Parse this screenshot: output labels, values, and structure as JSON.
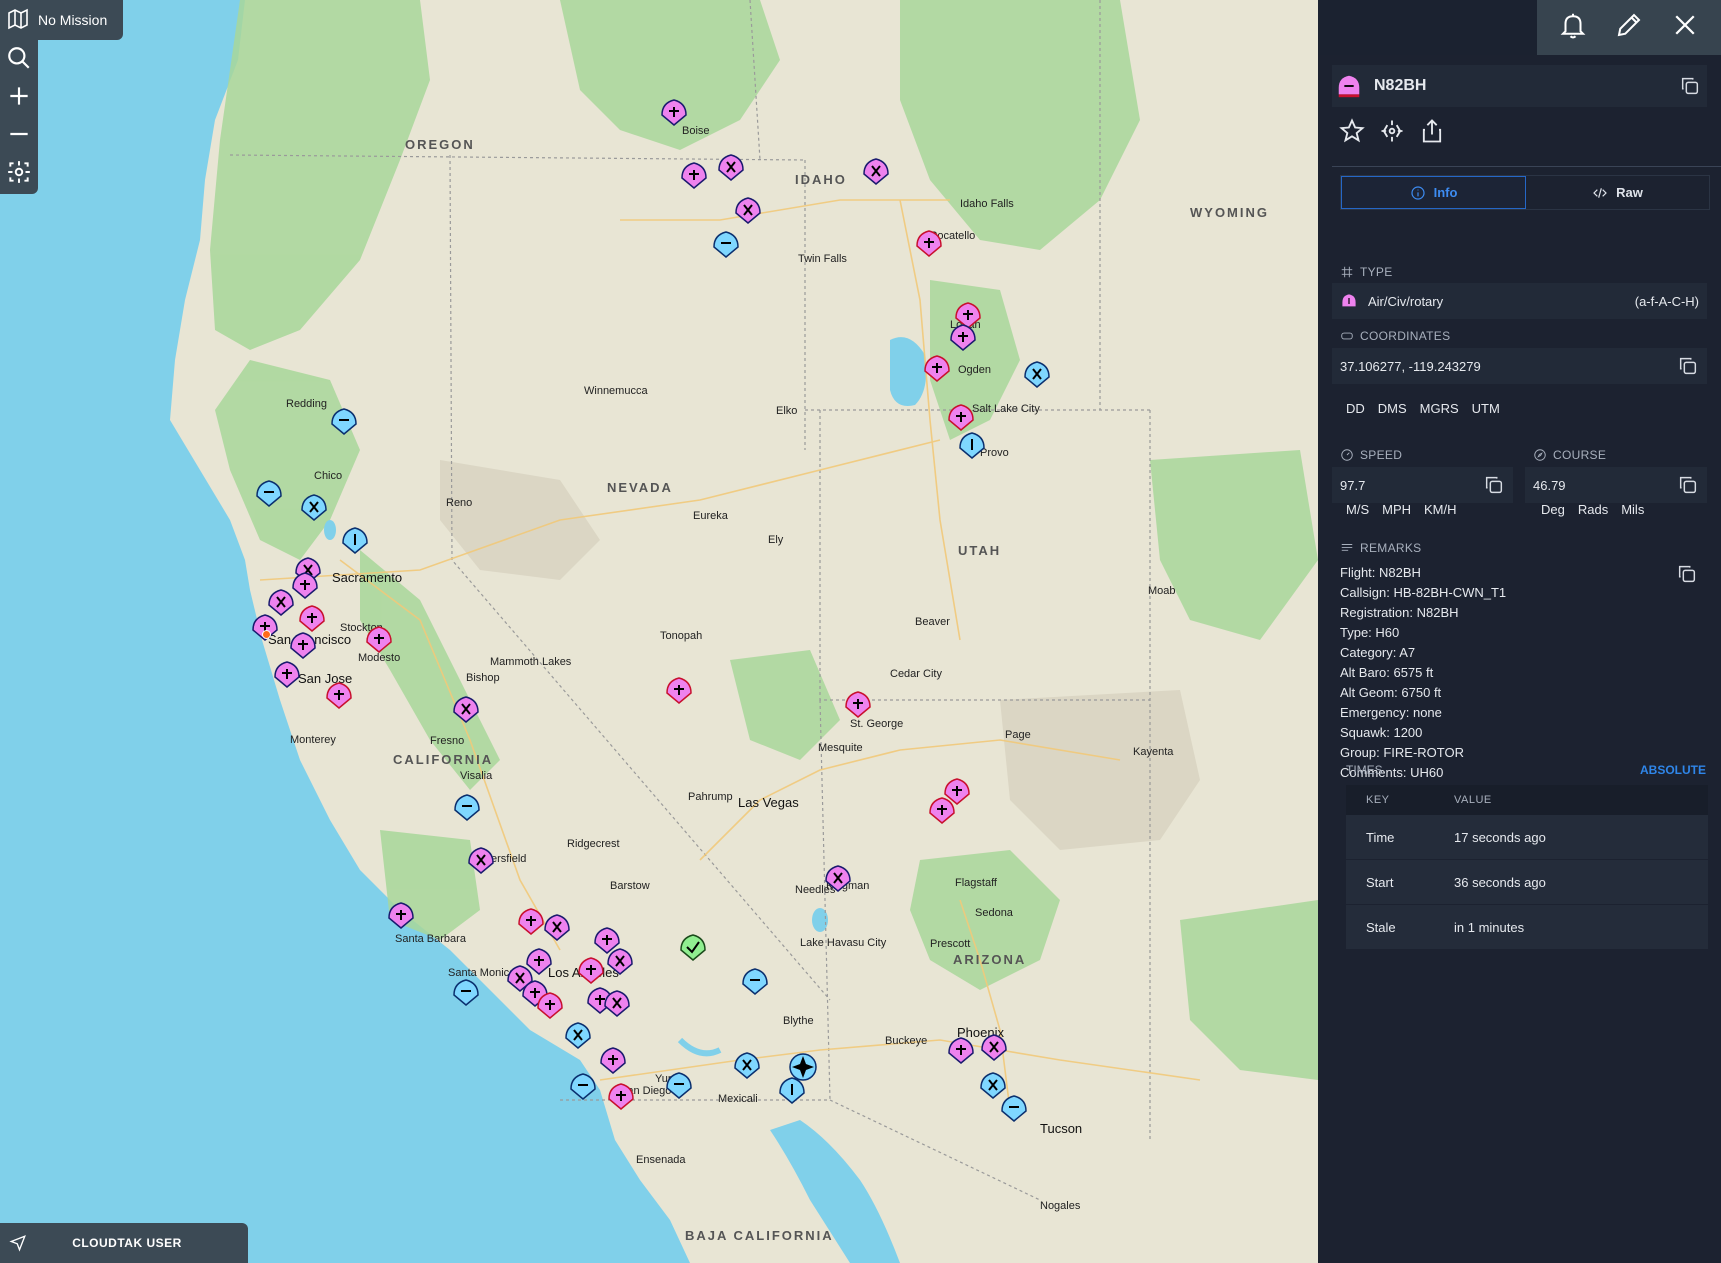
{
  "mission": {
    "label": "No Mission",
    "icon": "map-icon"
  },
  "map_tools": [
    "search-icon",
    "zoom-in-icon",
    "zoom-out-icon",
    "locate-icon"
  ],
  "user": {
    "name": "CLOUDTAK USER",
    "icon": "navigation-arrow-icon"
  },
  "top_right": [
    "bell-icon",
    "edit-pencil-icon",
    "close-icon"
  ],
  "map_labels": {
    "states": [
      "OREGON",
      "IDAHO",
      "WYOMING",
      "NEVADA",
      "UTAH",
      "CALIFORNIA",
      "ARIZONA",
      "BAJA CALIFORNIA"
    ],
    "cities": [
      "Sacramento",
      "San Francisco",
      "San Jose",
      "Stockton",
      "Modesto",
      "Fresno",
      "Visalia",
      "Bakersfield",
      "Las Vegas",
      "St. George",
      "Mesquite",
      "Provo",
      "Salt Lake City",
      "Ogden",
      "Reno",
      "Elko",
      "Phoenix",
      "Tucson",
      "Flagstaff",
      "San Diego",
      "Mexicali",
      "Ensenada",
      "Santa Barbara",
      "Los Angeles",
      "Boise",
      "Twin Falls",
      "Eureka",
      "Ely",
      "Winnemucca",
      "Kingman",
      "Prescott",
      "Sedona",
      "Yuma",
      "Lake Havasu City",
      "Nogales",
      "Santa Monica",
      "Pahrump",
      "Page",
      "Kayenta",
      "Tonopah",
      "Ridgecrest",
      "Monterey",
      "Chico",
      "Redding",
      "Moab",
      "Cedar City",
      "Beaver",
      "Bishop",
      "Barstow",
      "Needles",
      "Blythe",
      "Buckeye",
      "Mammoth Lakes",
      "Idaho Falls",
      "Pocatello",
      "Logan"
    ]
  },
  "panel": {
    "title": "N82BH",
    "avatar": "rotary-aircraft-icon",
    "actions": [
      "star-icon",
      "locate-target-icon",
      "share-icon"
    ],
    "tabs": {
      "info": "Info",
      "raw": "Raw"
    },
    "type": {
      "label": "TYPE",
      "value": "Air/Civ/rotary",
      "code": "(a-f-A-C-H)"
    },
    "coordinates": {
      "label": "COORDINATES",
      "value": "37.106277, -119.243279",
      "formats": [
        "DD",
        "DMS",
        "MGRS",
        "UTM"
      ]
    },
    "speed": {
      "label": "SPEED",
      "value": "97.7",
      "units": [
        "M/S",
        "MPH",
        "KM/H"
      ]
    },
    "course": {
      "label": "COURSE",
      "value": "46.79",
      "units": [
        "Deg",
        "Rads",
        "Mils"
      ]
    },
    "remarks": {
      "label": "REMARKS",
      "lines": [
        "Flight: N82BH",
        "Callsign: HB-82BH-CWN_T1",
        "Registration: N82BH",
        "Type: H60",
        "Category: A7",
        "Alt Baro: 6575 ft",
        "Alt Geom: 6750 ft",
        "Emergency: none",
        "Squawk: 1200",
        "Group: FIRE-ROTOR",
        "Comments: UH60"
      ]
    },
    "times": {
      "label": "TIMES",
      "mode": "ABSOLUTE",
      "headers": {
        "key": "KEY",
        "value": "VALUE"
      },
      "rows": [
        {
          "key": "Time",
          "value": "17 seconds ago"
        },
        {
          "key": "Start",
          "value": "36 seconds ago"
        },
        {
          "key": "Stale",
          "value": "in 1 minutes"
        }
      ]
    }
  },
  "colors": {
    "panel_bg": "#1c2230",
    "accent": "#2f86e9",
    "marker_civ_pink": "#ee82ee",
    "marker_friendly_blue": "#7fd7ff",
    "marker_green": "#90ee90",
    "water": "#7fcfe8"
  }
}
